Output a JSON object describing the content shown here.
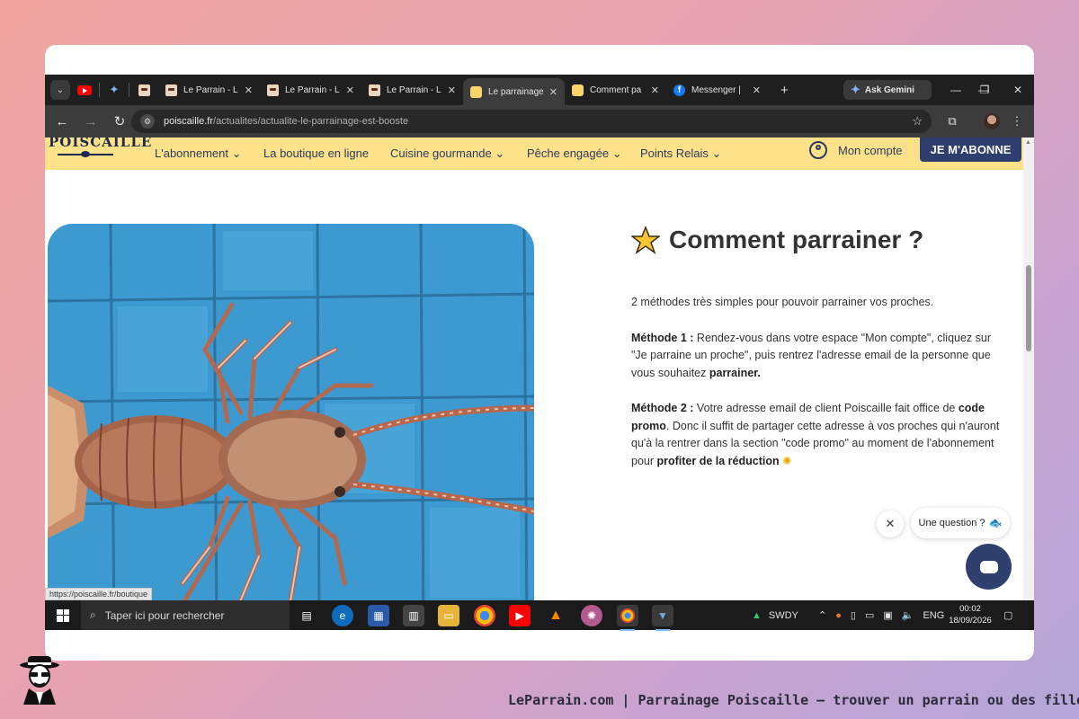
{
  "browser": {
    "tabs": [
      {
        "title": "Le Parrain - L",
        "favicon": "leparrain-favicon",
        "active": false
      },
      {
        "title": "Le Parrain - L",
        "favicon": "leparrain-favicon",
        "active": false
      },
      {
        "title": "Le Parrain - L",
        "favicon": "leparrain-favicon",
        "active": false
      },
      {
        "title": "Le parrainage",
        "favicon": "poiscaille-favicon",
        "active": true
      },
      {
        "title": "Comment pa",
        "favicon": "poiscaille-favicon",
        "active": false
      },
      {
        "title": "Messenger |",
        "favicon": "facebook-icon",
        "active": false
      }
    ],
    "gemini_label": "Ask Gemini",
    "url_host": "poiscaille.fr",
    "url_path": "/actualites/actualite-le-parrainage-est-booste",
    "status_url": "https://poiscaille.fr/boutique"
  },
  "site": {
    "logo": "POISCAILLE",
    "nav": {
      "abonnement": "L'abonnement",
      "boutique": "La boutique en ligne",
      "cuisine": "Cuisine gourmande",
      "peche": "Pêche engagée",
      "relais": "Points Relais"
    },
    "account_label": "Mon compte",
    "subscribe_label": "JE M'ABONNE",
    "article": {
      "title": "Comment parrainer ?",
      "intro": "2 méthodes très simples pour pouvoir parrainer vos proches.",
      "m1_label": "Méthode 1 :",
      "m1_text": " Rendez-vous dans votre espace \"Mon compte\", cliquez sur \"Je parraine un proche\", puis rentrez l'adresse email de la personne que vous souhaitez ",
      "m1_bold_end": "parrainer.",
      "m2_label": "Méthode 2 :",
      "m2_text_a": " Votre adresse email de client Poiscaille fait office de ",
      "m2_bold_a": "code promo",
      "m2_text_b": ". Donc il suffit de partager cette adresse à vos proches qui n'auront qu'à la rentrer dans la section \"code promo\" au moment de l'abonnement pour ",
      "m2_bold_b": "profiter de la réduction"
    },
    "chat_prompt": "Une question ?"
  },
  "taskbar": {
    "search_placeholder": "Taper ici pour rechercher",
    "ticker": "SWDY",
    "lang": "ENG",
    "time": "00:02",
    "date": "18/09/2026"
  },
  "footer": {
    "caption": "LeParrain.com | Parrainage Poiscaille — trouver un parrain ou des filleuls"
  },
  "colors": {
    "site_nav_bg": "#fde28a",
    "brand_navy": "#2e3e6e",
    "chrome_dark": "#1f1f1f"
  }
}
